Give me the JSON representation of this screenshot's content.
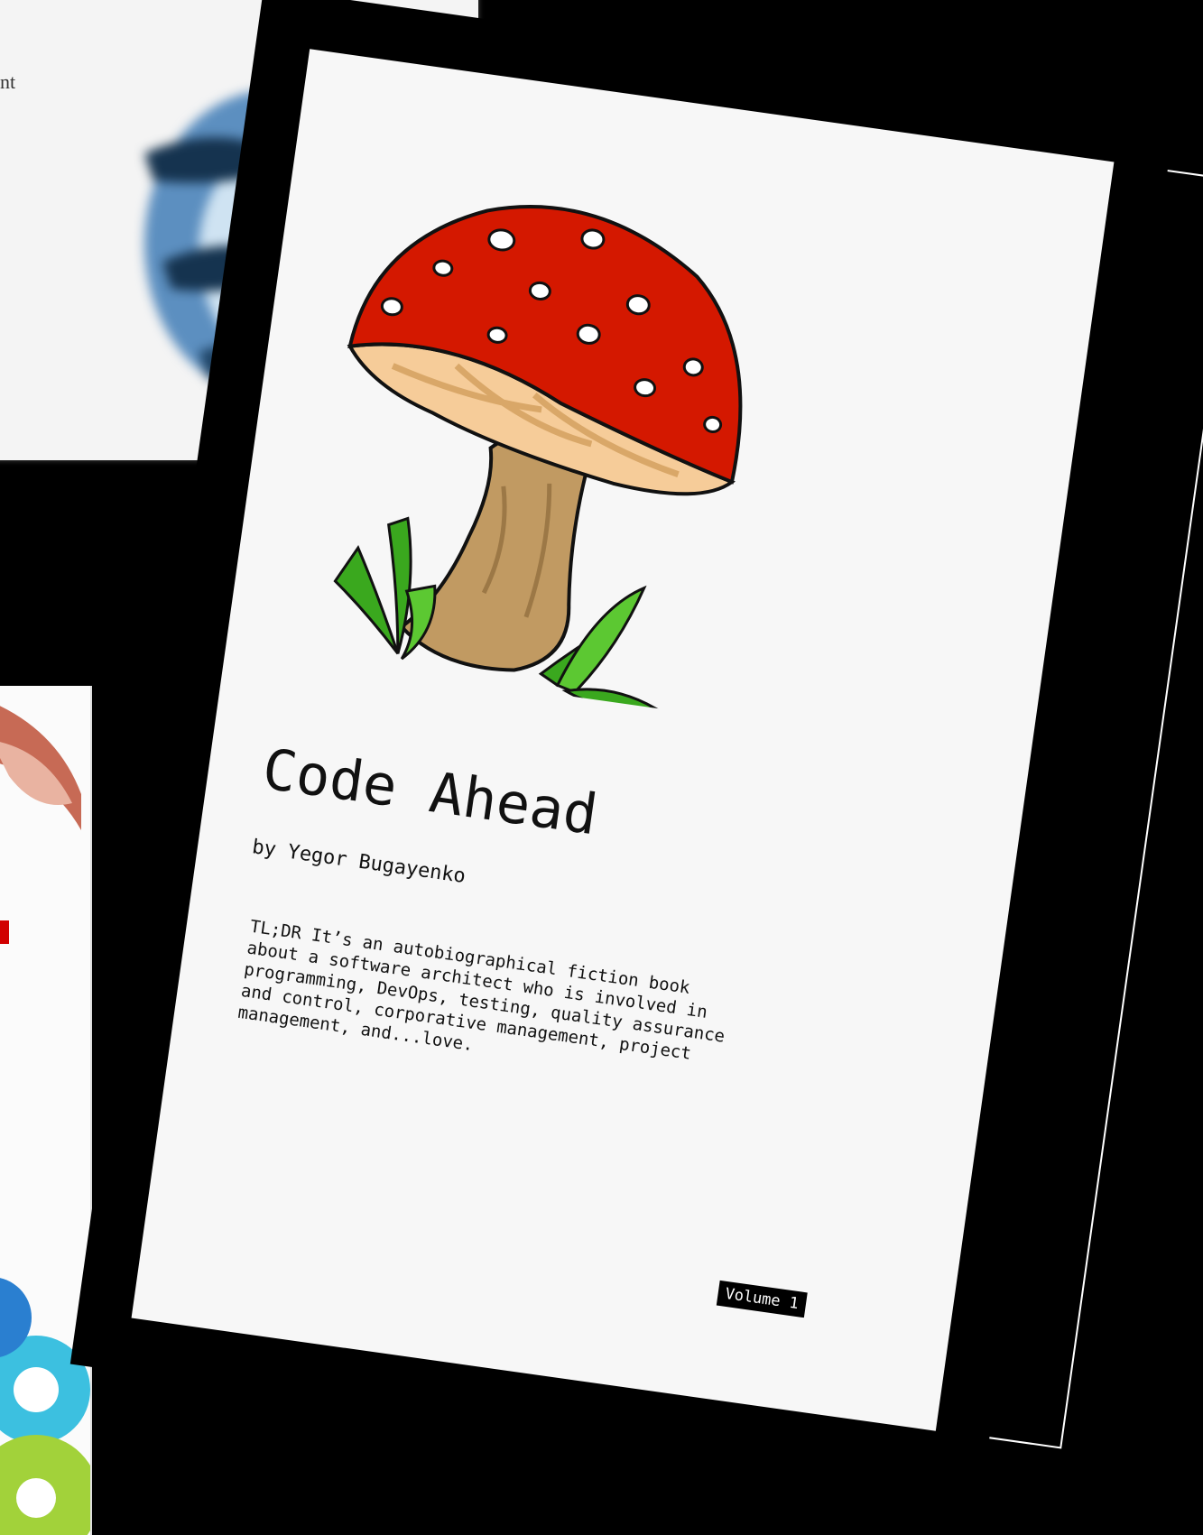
{
  "background_top_book": {
    "partial_text": "nt"
  },
  "cover": {
    "title": "Code Ahead",
    "author": "by Yegor Bugayenko",
    "tldr": "TL;DR It’s an autobiographical fiction book about a software architect who is involved in programming, DevOps, testing, quality assurance and control, corporative management, project management, and...love.",
    "volume_label": "Volume 1"
  },
  "colors": {
    "background": "#000000",
    "page": "#f7f7f7",
    "cap_red": "#d41800",
    "gill_tan": "#f6cc99",
    "stem_tan": "#c19a62",
    "grass_green": "#3aa81e"
  }
}
